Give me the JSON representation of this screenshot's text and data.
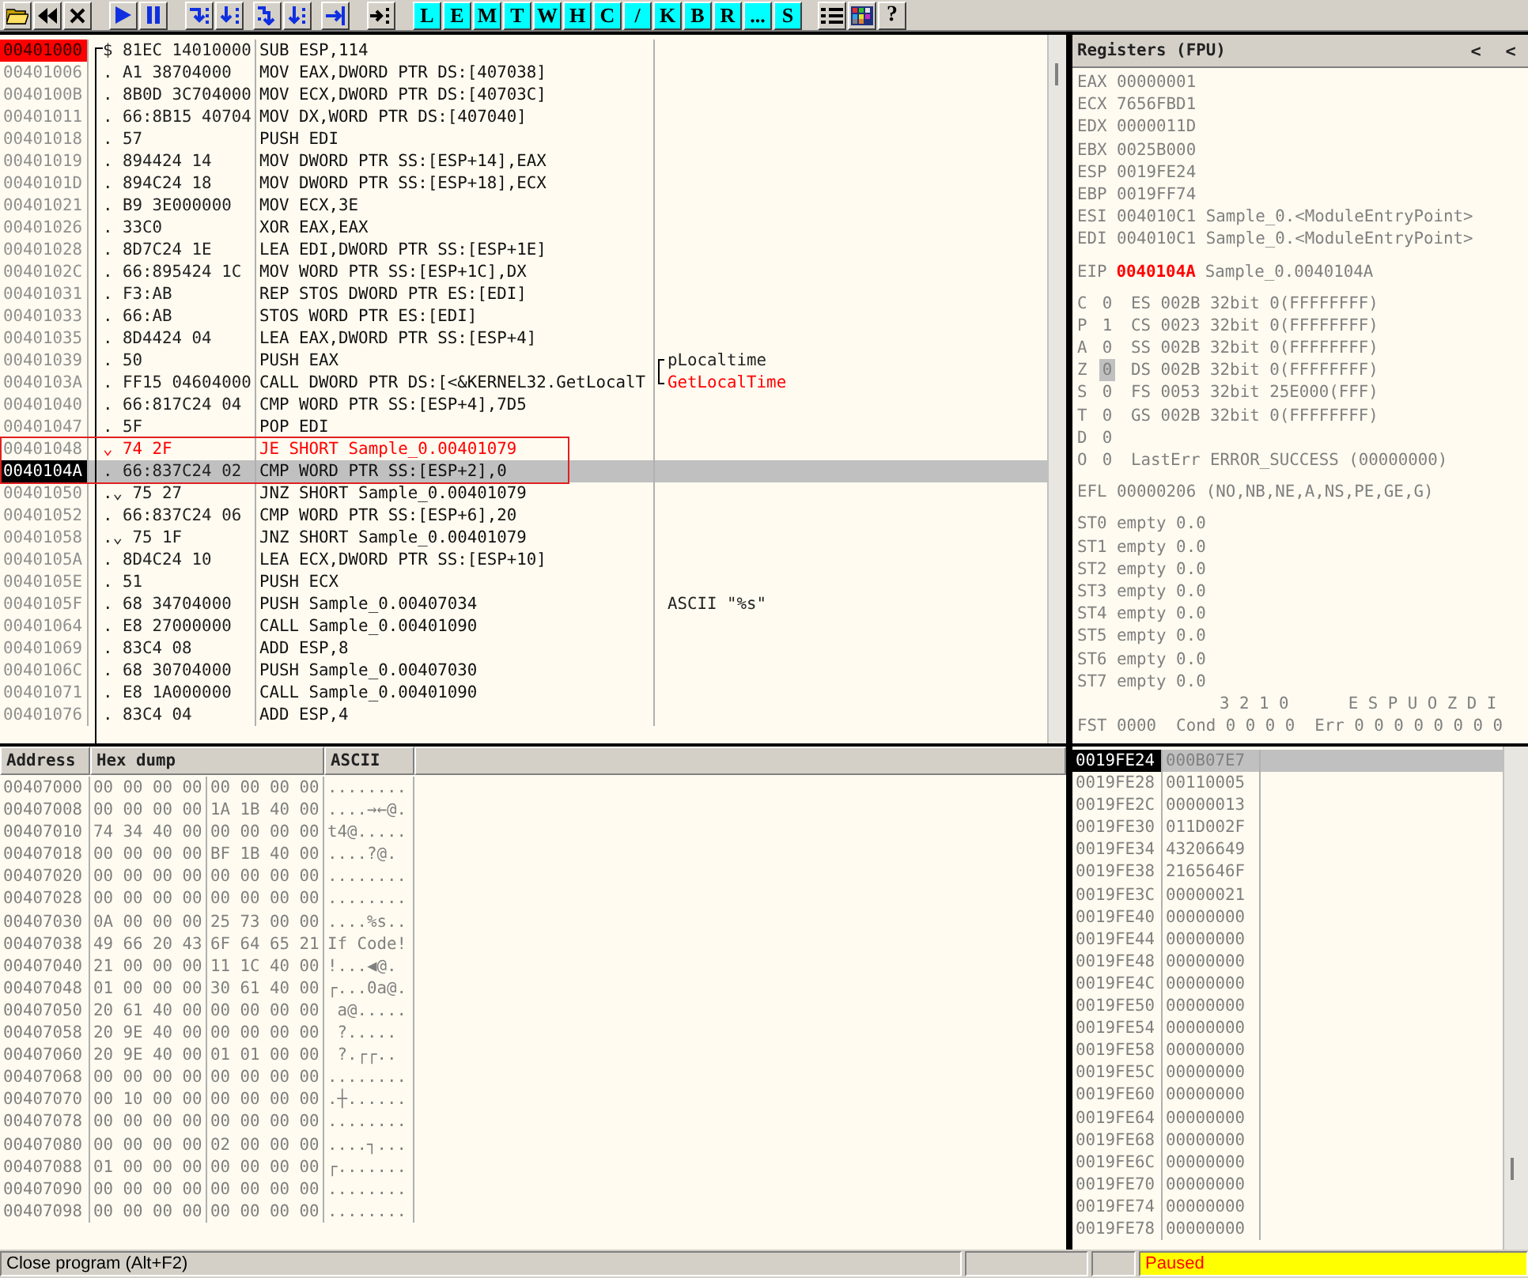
{
  "toolbar": {
    "window_buttons": [
      "L",
      "E",
      "M",
      "T",
      "W",
      "H",
      "C",
      "/",
      "K",
      "B",
      "R",
      "...",
      "S"
    ],
    "help_button": "?"
  },
  "disassembly": {
    "rows": [
      {
        "address": "00401000",
        "marker": "$",
        "hex": "81EC 14010000",
        "instruction": "SUB ESP,114",
        "breakpoint": true,
        "selected": false,
        "taken": false,
        "boxed": false,
        "procedure_start": true
      },
      {
        "address": "00401006",
        "marker": ".",
        "hex": "A1 38704000",
        "instruction": "MOV EAX,DWORD PTR DS:[407038]",
        "breakpoint": false,
        "selected": false,
        "taken": false,
        "boxed": false
      },
      {
        "address": "0040100B",
        "marker": ".",
        "hex": "8B0D 3C704000",
        "instruction": "MOV ECX,DWORD PTR DS:[40703C]",
        "breakpoint": false,
        "selected": false,
        "taken": false,
        "boxed": false
      },
      {
        "address": "00401011",
        "marker": ".",
        "hex": "66:8B15 40704",
        "instruction": "MOV DX,WORD PTR DS:[407040]",
        "breakpoint": false,
        "selected": false,
        "taken": false,
        "boxed": false
      },
      {
        "address": "00401018",
        "marker": ".",
        "hex": "57",
        "instruction": "PUSH EDI",
        "breakpoint": false,
        "selected": false,
        "taken": false,
        "boxed": false
      },
      {
        "address": "00401019",
        "marker": ".",
        "hex": "894424 14",
        "instruction": "MOV DWORD PTR SS:[ESP+14],EAX",
        "breakpoint": false,
        "selected": false,
        "taken": false,
        "boxed": false
      },
      {
        "address": "0040101D",
        "marker": ".",
        "hex": "894C24 18",
        "instruction": "MOV DWORD PTR SS:[ESP+18],ECX",
        "breakpoint": false,
        "selected": false,
        "taken": false,
        "boxed": false
      },
      {
        "address": "00401021",
        "marker": ".",
        "hex": "B9 3E000000",
        "instruction": "MOV ECX,3E",
        "breakpoint": false,
        "selected": false,
        "taken": false,
        "boxed": false
      },
      {
        "address": "00401026",
        "marker": ".",
        "hex": "33C0",
        "instruction": "XOR EAX,EAX",
        "breakpoint": false,
        "selected": false,
        "taken": false,
        "boxed": false
      },
      {
        "address": "00401028",
        "marker": ".",
        "hex": "8D7C24 1E",
        "instruction": "LEA EDI,DWORD PTR SS:[ESP+1E]",
        "breakpoint": false,
        "selected": false,
        "taken": false,
        "boxed": false
      },
      {
        "address": "0040102C",
        "marker": ".",
        "hex": "66:895424 1C",
        "instruction": "MOV WORD PTR SS:[ESP+1C],DX",
        "breakpoint": false,
        "selected": false,
        "taken": false,
        "boxed": false
      },
      {
        "address": "00401031",
        "marker": ".",
        "hex": "F3:AB",
        "instruction": "REP STOS DWORD PTR ES:[EDI]",
        "breakpoint": false,
        "selected": false,
        "taken": false,
        "boxed": false
      },
      {
        "address": "00401033",
        "marker": ".",
        "hex": "66:AB",
        "instruction": "STOS WORD PTR ES:[EDI]",
        "breakpoint": false,
        "selected": false,
        "taken": false,
        "boxed": false
      },
      {
        "address": "00401035",
        "marker": ".",
        "hex": "8D4424 04",
        "instruction": "LEA EAX,DWORD PTR SS:[ESP+4]",
        "breakpoint": false,
        "selected": false,
        "taken": false,
        "boxed": false
      },
      {
        "address": "00401039",
        "marker": ".",
        "hex": "50",
        "instruction": "PUSH EAX",
        "comment": "pLocaltime",
        "kind": "argument",
        "breakpoint": false,
        "selected": false,
        "taken": false,
        "boxed": false
      },
      {
        "address": "0040103A",
        "marker": ".",
        "hex": "FF15 04604000",
        "instruction": "CALL DWORD PTR DS:[<&KERNEL32.GetLocalT",
        "comment": "GetLocalTime",
        "kind": "api",
        "breakpoint": false,
        "selected": false,
        "taken": false,
        "boxed": false
      },
      {
        "address": "00401040",
        "marker": ".",
        "hex": "66:817C24 04",
        "instruction": "CMP WORD PTR SS:[ESP+4],7D5",
        "breakpoint": false,
        "selected": false,
        "taken": false,
        "boxed": false
      },
      {
        "address": "00401047",
        "marker": ".",
        "hex": "5F",
        "instruction": "POP EDI",
        "breakpoint": false,
        "selected": false,
        "taken": false,
        "boxed": false
      },
      {
        "address": "00401048",
        "marker": "⌄",
        "hex": "74 2F",
        "instruction": "JE SHORT Sample_0.00401079",
        "breakpoint": false,
        "selected": false,
        "taken": true,
        "boxed": true
      },
      {
        "address": "0040104A",
        "marker": ".",
        "hex": "66:837C24 02",
        "instruction": "CMP WORD PTR SS:[ESP+2],0",
        "breakpoint": false,
        "selected": true,
        "taken": false,
        "boxed": true
      },
      {
        "address": "00401050",
        "marker": ".⌄",
        "hex": "75 27",
        "instruction": "JNZ SHORT Sample_0.00401079",
        "breakpoint": false,
        "selected": false,
        "taken": false,
        "boxed": false
      },
      {
        "address": "00401052",
        "marker": ".",
        "hex": "66:837C24 06",
        "instruction": "CMP WORD PTR SS:[ESP+6],20",
        "breakpoint": false,
        "selected": false,
        "taken": false,
        "boxed": false
      },
      {
        "address": "00401058",
        "marker": ".⌄",
        "hex": "75 1F",
        "instruction": "JNZ SHORT Sample_0.00401079",
        "breakpoint": false,
        "selected": false,
        "taken": false,
        "boxed": false
      },
      {
        "address": "0040105A",
        "marker": ".",
        "hex": "8D4C24 10",
        "instruction": "LEA ECX,DWORD PTR SS:[ESP+10]",
        "breakpoint": false,
        "selected": false,
        "taken": false,
        "boxed": false
      },
      {
        "address": "0040105E",
        "marker": ".",
        "hex": "51",
        "instruction": "PUSH ECX",
        "breakpoint": false,
        "selected": false,
        "taken": false,
        "boxed": false
      },
      {
        "address": "0040105F",
        "marker": ".",
        "hex": "68 34704000",
        "instruction": "PUSH Sample_0.00407034",
        "comment": "ASCII \"%s\"",
        "kind": "string",
        "breakpoint": false,
        "selected": false,
        "taken": false,
        "boxed": false
      },
      {
        "address": "00401064",
        "marker": ".",
        "hex": "E8 27000000",
        "instruction": "CALL Sample_0.00401090",
        "breakpoint": false,
        "selected": false,
        "taken": false,
        "boxed": false
      },
      {
        "address": "00401069",
        "marker": ".",
        "hex": "83C4 08",
        "instruction": "ADD ESP,8",
        "breakpoint": false,
        "selected": false,
        "taken": false,
        "boxed": false
      },
      {
        "address": "0040106C",
        "marker": ".",
        "hex": "68 30704000",
        "instruction": "PUSH Sample_0.00407030",
        "breakpoint": false,
        "selected": false,
        "taken": false,
        "boxed": false
      },
      {
        "address": "00401071",
        "marker": ".",
        "hex": "E8 1A000000",
        "instruction": "CALL Sample_0.00401090",
        "breakpoint": false,
        "selected": false,
        "taken": false,
        "boxed": false
      },
      {
        "address": "00401076",
        "marker": ".",
        "hex": "83C4 04",
        "instruction": "ADD ESP,4",
        "breakpoint": false,
        "selected": false,
        "taken": false,
        "boxed": false
      }
    ]
  },
  "registers": {
    "title": "Registers (FPU)",
    "header_buttons": [
      "<",
      "<"
    ],
    "general": [
      {
        "name": "EAX",
        "value": "00000001"
      },
      {
        "name": "ECX",
        "value": "7656FBD1"
      },
      {
        "name": "EDX",
        "value": "0000011D"
      },
      {
        "name": "EBX",
        "value": "0025B000"
      },
      {
        "name": "ESP",
        "value": "0019FE24"
      },
      {
        "name": "EBP",
        "value": "0019FF74"
      },
      {
        "name": "ESI",
        "value": "004010C1",
        "info": "Sample_0.<ModuleEntryPoint>"
      },
      {
        "name": "EDI",
        "value": "004010C1",
        "info": "Sample_0.<ModuleEntryPoint>"
      }
    ],
    "eip": {
      "name": "EIP",
      "value": "0040104A",
      "info": "Sample_0.0040104A",
      "changed": true
    },
    "flags": [
      {
        "name": "C",
        "value": "0",
        "detail": "ES 002B 32bit 0(FFFFFFFF)",
        "selected": false
      },
      {
        "name": "P",
        "value": "1",
        "detail": "CS 0023 32bit 0(FFFFFFFF)",
        "selected": false
      },
      {
        "name": "A",
        "value": "0",
        "detail": "SS 002B 32bit 0(FFFFFFFF)",
        "selected": false
      },
      {
        "name": "Z",
        "value": "0",
        "detail": "DS 002B 32bit 0(FFFFFFFF)",
        "selected": true
      },
      {
        "name": "S",
        "value": "0",
        "detail": "FS 0053 32bit 25E000(FFF)",
        "selected": false
      },
      {
        "name": "T",
        "value": "0",
        "detail": "GS 002B 32bit 0(FFFFFFFF)",
        "selected": false
      },
      {
        "name": "D",
        "value": "0",
        "selected": false
      },
      {
        "name": "O",
        "value": "0",
        "detail": "LastErr ERROR_SUCCESS (00000000)",
        "selected": false
      }
    ],
    "efl": {
      "name": "EFL",
      "value": "00000206",
      "info": "(NO,NB,NE,A,NS,PE,GE,G)"
    },
    "fpu": [
      {
        "name": "ST0",
        "value": "empty 0.0"
      },
      {
        "name": "ST1",
        "value": "empty 0.0"
      },
      {
        "name": "ST2",
        "value": "empty 0.0"
      },
      {
        "name": "ST3",
        "value": "empty 0.0"
      },
      {
        "name": "ST4",
        "value": "empty 0.0"
      },
      {
        "name": "ST5",
        "value": "empty 0.0"
      },
      {
        "name": "ST6",
        "value": "empty 0.0"
      },
      {
        "name": "ST7",
        "value": "empty 0.0"
      }
    ],
    "fst_header": "3 2 1 0      E S P U O Z D I",
    "fst": "FST 0000  Cond 0 0 0 0  Err 0 0 0 0 0 0 0 0"
  },
  "dump": {
    "columns": [
      "Address",
      "Hex dump",
      "ASCII"
    ],
    "rows": [
      {
        "address": "00407000",
        "hex": [
          "00 00 00 00",
          "00 00 00 00"
        ],
        "ascii": "........"
      },
      {
        "address": "00407008",
        "hex": [
          "00 00 00 00",
          "1A 1B 40 00"
        ],
        "ascii": "....→←@."
      },
      {
        "address": "00407010",
        "hex": [
          "74 34 40 00",
          "00 00 00 00"
        ],
        "ascii": "t4@....."
      },
      {
        "address": "00407018",
        "hex": [
          "00 00 00 00",
          "BF 1B 40 00"
        ],
        "ascii": "....?@."
      },
      {
        "address": "00407020",
        "hex": [
          "00 00 00 00",
          "00 00 00 00"
        ],
        "ascii": "........"
      },
      {
        "address": "00407028",
        "hex": [
          "00 00 00 00",
          "00 00 00 00"
        ],
        "ascii": "........"
      },
      {
        "address": "00407030",
        "hex": [
          "0A 00 00 00",
          "25 73 00 00"
        ],
        "ascii": "....%s.."
      },
      {
        "address": "00407038",
        "hex": [
          "49 66 20 43",
          "6F 64 65 21"
        ],
        "ascii": "If Code!"
      },
      {
        "address": "00407040",
        "hex": [
          "21 00 00 00",
          "11 1C 40 00"
        ],
        "ascii": "!...◀@."
      },
      {
        "address": "00407048",
        "hex": [
          "01 00 00 00",
          "30 61 40 00"
        ],
        "ascii": "┌...0a@."
      },
      {
        "address": "00407050",
        "hex": [
          "20 61 40 00",
          "00 00 00 00"
        ],
        "ascii": " a@....."
      },
      {
        "address": "00407058",
        "hex": [
          "20 9E 40 00",
          "00 00 00 00"
        ],
        "ascii": " ?....."
      },
      {
        "address": "00407060",
        "hex": [
          "20 9E 40 00",
          "01 01 00 00"
        ],
        "ascii": " ?.┌┌.."
      },
      {
        "address": "00407068",
        "hex": [
          "00 00 00 00",
          "00 00 00 00"
        ],
        "ascii": "........"
      },
      {
        "address": "00407070",
        "hex": [
          "00 10 00 00",
          "00 00 00 00"
        ],
        "ascii": ".┼......"
      },
      {
        "address": "00407078",
        "hex": [
          "00 00 00 00",
          "00 00 00 00"
        ],
        "ascii": "........"
      },
      {
        "address": "00407080",
        "hex": [
          "00 00 00 00",
          "02 00 00 00"
        ],
        "ascii": "....┐..."
      },
      {
        "address": "00407088",
        "hex": [
          "01 00 00 00",
          "00 00 00 00"
        ],
        "ascii": "┌......."
      },
      {
        "address": "00407090",
        "hex": [
          "00 00 00 00",
          "00 00 00 00"
        ],
        "ascii": "........"
      },
      {
        "address": "00407098",
        "hex": [
          "00 00 00 00",
          "00 00 00 00"
        ],
        "ascii": "........"
      }
    ]
  },
  "stack": {
    "rows": [
      {
        "address": "0019FE24",
        "value": "000B07E7",
        "selected": true
      },
      {
        "address": "0019FE28",
        "value": "00110005",
        "selected": false
      },
      {
        "address": "0019FE2C",
        "value": "00000013",
        "selected": false
      },
      {
        "address": "0019FE30",
        "value": "011D002F",
        "selected": false
      },
      {
        "address": "0019FE34",
        "value": "43206649",
        "selected": false
      },
      {
        "address": "0019FE38",
        "value": "2165646F",
        "selected": false
      },
      {
        "address": "0019FE3C",
        "value": "00000021",
        "selected": false
      },
      {
        "address": "0019FE40",
        "value": "00000000",
        "selected": false
      },
      {
        "address": "0019FE44",
        "value": "00000000",
        "selected": false
      },
      {
        "address": "0019FE48",
        "value": "00000000",
        "selected": false
      },
      {
        "address": "0019FE4C",
        "value": "00000000",
        "selected": false
      },
      {
        "address": "0019FE50",
        "value": "00000000",
        "selected": false
      },
      {
        "address": "0019FE54",
        "value": "00000000",
        "selected": false
      },
      {
        "address": "0019FE58",
        "value": "00000000",
        "selected": false
      },
      {
        "address": "0019FE5C",
        "value": "00000000",
        "selected": false
      },
      {
        "address": "0019FE60",
        "value": "00000000",
        "selected": false
      },
      {
        "address": "0019FE64",
        "value": "00000000",
        "selected": false
      },
      {
        "address": "0019FE68",
        "value": "00000000",
        "selected": false
      },
      {
        "address": "0019FE6C",
        "value": "00000000",
        "selected": false
      },
      {
        "address": "0019FE70",
        "value": "00000000",
        "selected": false
      },
      {
        "address": "0019FE74",
        "value": "00000000",
        "selected": false
      },
      {
        "address": "0019FE78",
        "value": "00000000",
        "selected": false
      }
    ]
  },
  "status_bar": {
    "message": "Close program (Alt+F2)",
    "state": "Paused"
  }
}
